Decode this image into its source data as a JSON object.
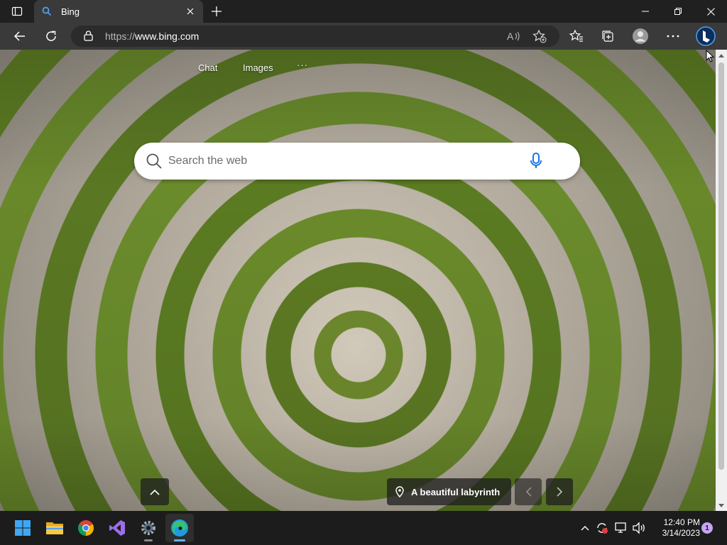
{
  "browser": {
    "tab": {
      "title": "Bing"
    },
    "address": {
      "protocol": "https://",
      "host": "www.bing.com"
    }
  },
  "bing": {
    "top_links": [
      "Chat",
      "Images"
    ],
    "more_label": "···",
    "search": {
      "placeholder": "Search the web",
      "value": ""
    },
    "image_caption": "A beautiful labyrinth"
  },
  "taskbar": {
    "apps": [
      {
        "name": "Start",
        "icon": "windows-start-icon"
      },
      {
        "name": "File Explorer",
        "icon": "file-explorer-icon"
      },
      {
        "name": "Google Chrome",
        "icon": "chrome-icon"
      },
      {
        "name": "Visual Studio",
        "icon": "visual-studio-icon"
      },
      {
        "name": "Settings",
        "icon": "settings-gear-icon"
      },
      {
        "name": "Microsoft Edge",
        "icon": "edge-icon"
      }
    ],
    "clock": {
      "time": "12:40 PM",
      "date": "3/14/2023"
    },
    "notification_count": "1"
  },
  "colors": {
    "titlebar": "#202020",
    "toolbar": "#3a3a3a",
    "taskbar": "#1c1c1c",
    "bing_blue": "#1a73e8",
    "edge_accent": "#5fb2f2"
  }
}
